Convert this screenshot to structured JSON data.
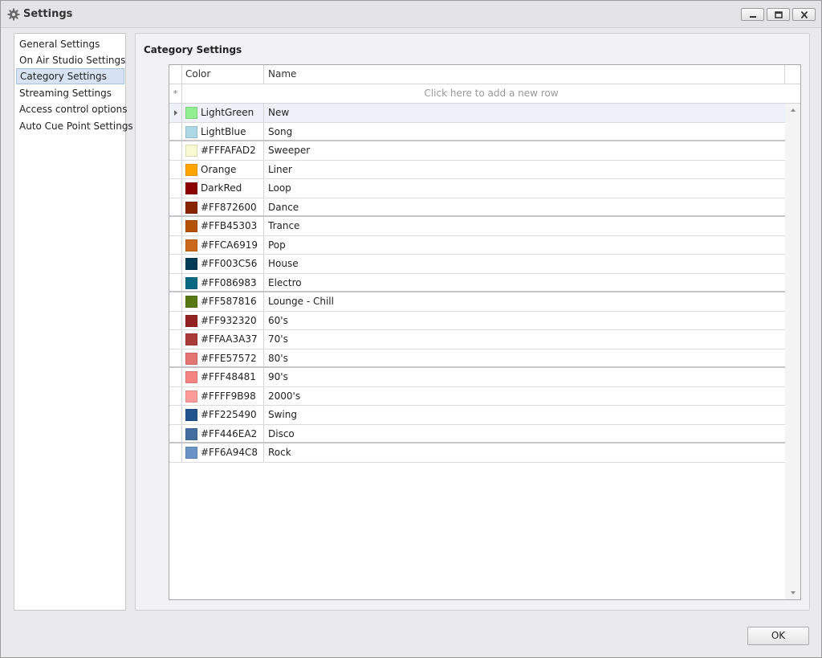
{
  "window": {
    "title": "Settings"
  },
  "sidebar": {
    "items": [
      {
        "label": "General Settings"
      },
      {
        "label": "On Air Studio Settings"
      },
      {
        "label": "Category Settings",
        "active": true
      },
      {
        "label": "Streaming Settings"
      },
      {
        "label": "Access control options"
      },
      {
        "label": "Auto Cue Point Settings"
      }
    ]
  },
  "panel": {
    "title": "Category Settings"
  },
  "grid": {
    "columns": [
      "Color",
      "Name"
    ],
    "new_row_marker": "*",
    "new_row_text": "Click here to add a new row",
    "rows": [
      {
        "color_label": "LightGreen",
        "color_hex": "#90EE90",
        "name": "New"
      },
      {
        "color_label": "LightBlue",
        "color_hex": "#ADD8E6",
        "name": "Song"
      },
      {
        "color_label": "#FFFAFAD2",
        "color_hex": "#FAFAD2",
        "name": "Sweeper"
      },
      {
        "color_label": "Orange",
        "color_hex": "#FFA500",
        "name": "Liner"
      },
      {
        "color_label": "DarkRed",
        "color_hex": "#8B0000",
        "name": "Loop"
      },
      {
        "color_label": "#FF872600",
        "color_hex": "#872600",
        "name": "Dance"
      },
      {
        "color_label": "#FFB45303",
        "color_hex": "#B45303",
        "name": "Trance"
      },
      {
        "color_label": "#FFCA6919",
        "color_hex": "#CA6919",
        "name": "Pop"
      },
      {
        "color_label": "#FF003C56",
        "color_hex": "#003C56",
        "name": "House"
      },
      {
        "color_label": "#FF086983",
        "color_hex": "#086983",
        "name": "Electro"
      },
      {
        "color_label": "#FF587816",
        "color_hex": "#587816",
        "name": "Lounge - Chill"
      },
      {
        "color_label": "#FF932320",
        "color_hex": "#932320",
        "name": "60's"
      },
      {
        "color_label": "#FFAA3A37",
        "color_hex": "#AA3A37",
        "name": "70's"
      },
      {
        "color_label": "#FFE57572",
        "color_hex": "#E57572",
        "name": "80's"
      },
      {
        "color_label": "#FFF48481",
        "color_hex": "#F48481",
        "name": "90's"
      },
      {
        "color_label": "#FFFF9B98",
        "color_hex": "#FF9B98",
        "name": "2000's"
      },
      {
        "color_label": "#FF225490",
        "color_hex": "#225490",
        "name": "Swing"
      },
      {
        "color_label": "#FF446EA2",
        "color_hex": "#446EA2",
        "name": "Disco"
      },
      {
        "color_label": "#FF6A94C8",
        "color_hex": "#6A94C8",
        "name": "Rock"
      }
    ]
  },
  "footer": {
    "ok_label": "OK"
  },
  "icons": {
    "title": "gear-icon",
    "minimize": "minimize-icon",
    "maximize": "maximize-icon",
    "close": "close-icon",
    "row_pointer": "row-pointer-icon"
  }
}
